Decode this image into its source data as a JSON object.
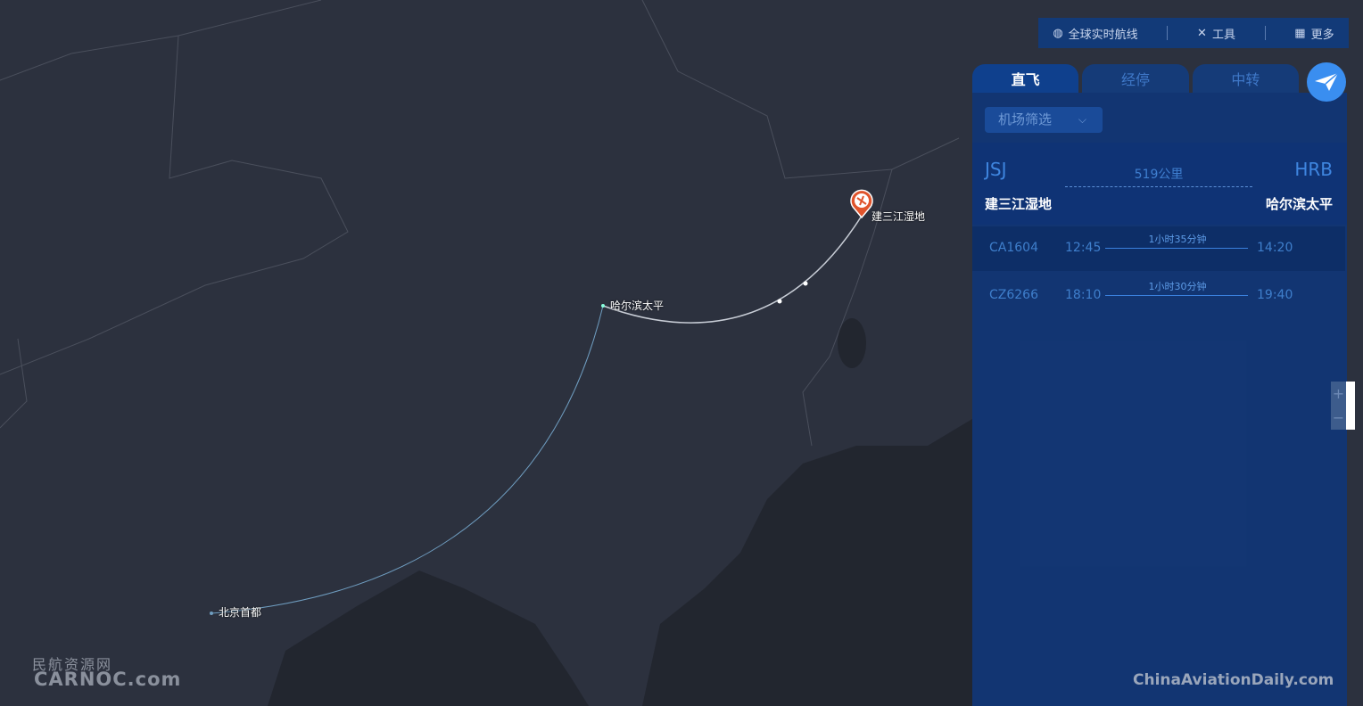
{
  "topbar": {
    "items": [
      {
        "icon": "globe-icon",
        "label": "全球实时航线"
      },
      {
        "icon": "tools-icon",
        "label": "工具"
      },
      {
        "icon": "grid-icon",
        "label": "更多"
      }
    ]
  },
  "tabs": [
    {
      "label": "直飞",
      "active": true
    },
    {
      "label": "经停",
      "active": false
    },
    {
      "label": "中转",
      "active": false
    }
  ],
  "filter": {
    "label": "机场筛选"
  },
  "route": {
    "from_code": "JSJ",
    "from_name": "建三江湿地",
    "to_code": "HRB",
    "to_name": "哈尔滨太平",
    "distance": "519公里"
  },
  "flights": [
    {
      "no": "CA1604",
      "dep": "12:45",
      "duration": "1小时35分钟",
      "arr": "14:20",
      "selected": true
    },
    {
      "no": "CZ6266",
      "dep": "18:10",
      "duration": "1小时30分钟",
      "arr": "19:40",
      "selected": false
    }
  ],
  "map": {
    "labels": {
      "jsj": "建三江湿地",
      "hrb": "哈尔滨太平",
      "pek": "北京首都"
    },
    "route_color": "#c8cdd6",
    "secondary_route_color": "#6f9dc0",
    "marker_color": "#e0542c"
  },
  "zoom": {
    "in": "+",
    "out": "−"
  },
  "watermarks": {
    "left_cn": "民航资源网",
    "left_en": "CARNOC.com",
    "right": "ChinaAviationDaily.com"
  }
}
